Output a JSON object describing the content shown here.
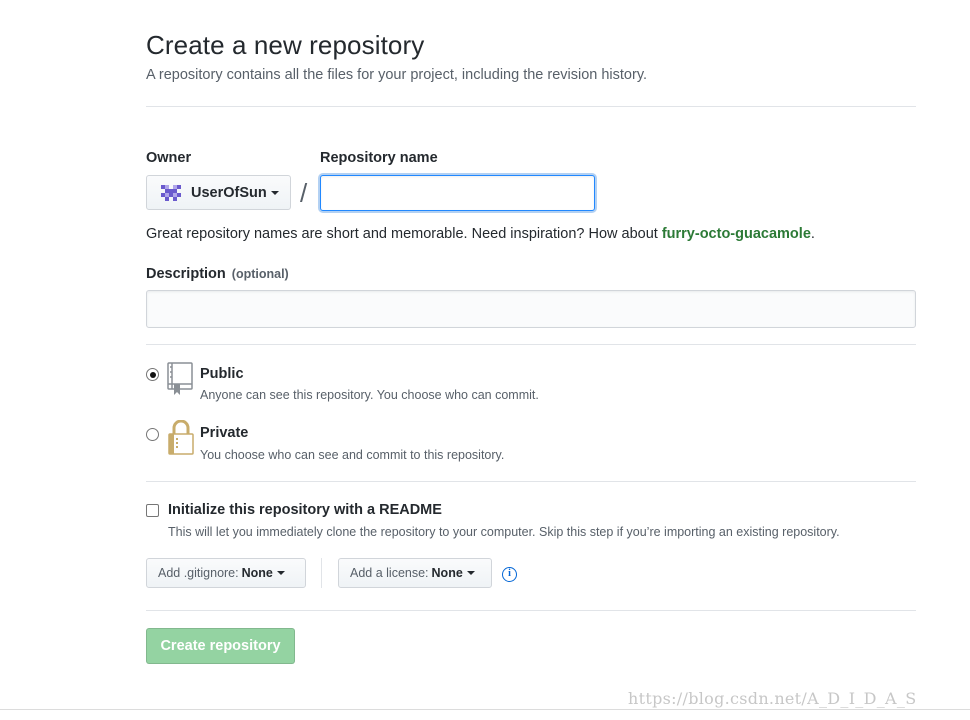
{
  "header": {
    "title": "Create a new repository",
    "subtitle": "A repository contains all the files for your project, including the revision history."
  },
  "owner": {
    "label": "Owner",
    "value": "UserOfSun",
    "avatar_icon": "identicon-avatar"
  },
  "separator": "/",
  "repo_name": {
    "label": "Repository name",
    "value": ""
  },
  "hint": {
    "text": "Great repository names are short and memorable. Need inspiration? How about ",
    "suggestion": "furry-octo-guacamole",
    "end": "."
  },
  "description": {
    "label": "Description",
    "optional": "(optional)",
    "value": ""
  },
  "visibility": {
    "public": {
      "title": "Public",
      "note": "Anyone can see this repository. You choose who can commit.",
      "icon": "repo-book-icon",
      "selected": true
    },
    "private": {
      "title": "Private",
      "note": "You choose who can see and commit to this repository.",
      "icon": "lock-icon",
      "selected": false
    }
  },
  "init": {
    "title": "Initialize this repository with a README",
    "note": "This will let you immediately clone the repository to your computer. Skip this step if you’re importing an existing repository.",
    "checked": false
  },
  "gitignore": {
    "label": "Add .gitignore:",
    "value": "None"
  },
  "license": {
    "label": "Add a license:",
    "value": "None"
  },
  "submit": {
    "label": "Create repository"
  },
  "watermark": "https://blog.csdn.net/A_D_I_D_A_S",
  "colors": {
    "accent_focus": "#2188ff",
    "submit_disabled": "#94d3a2",
    "suggestion": "#2c7a36",
    "info": "#0366d6",
    "avatar": "#6a5acd"
  }
}
